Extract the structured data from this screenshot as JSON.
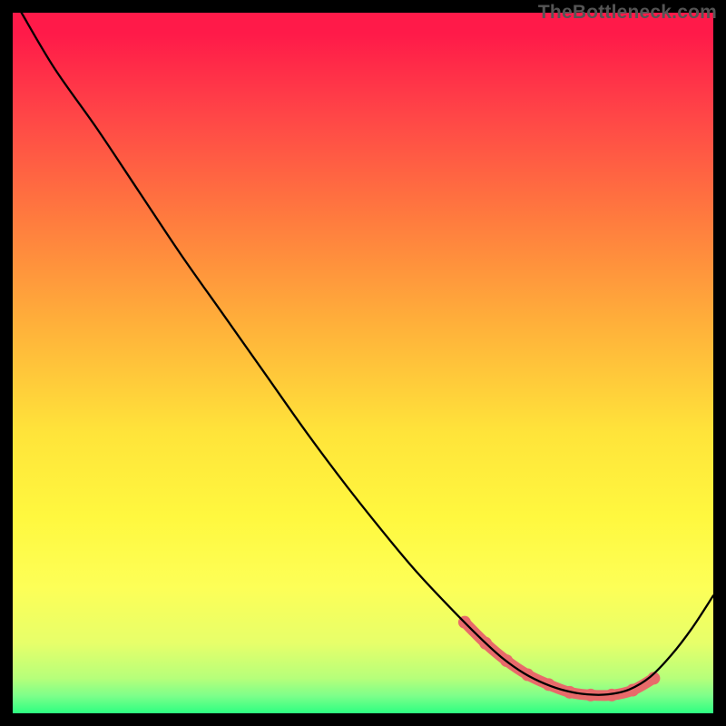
{
  "watermark": "TheBottleneck.com",
  "chart_data": {
    "type": "line",
    "title": "",
    "xlabel": "",
    "ylabel": "",
    "xlim": [
      0,
      100
    ],
    "ylim": [
      0,
      100
    ],
    "grid": false,
    "legend": false,
    "gradient_stops": [
      {
        "offset": 0.0,
        "color": "#ff1a49"
      },
      {
        "offset": 0.03,
        "color": "#ff1a49"
      },
      {
        "offset": 0.15,
        "color": "#ff4747"
      },
      {
        "offset": 0.3,
        "color": "#ff7d3e"
      },
      {
        "offset": 0.45,
        "color": "#ffb23a"
      },
      {
        "offset": 0.6,
        "color": "#ffe43a"
      },
      {
        "offset": 0.72,
        "color": "#fff83f"
      },
      {
        "offset": 0.82,
        "color": "#fdff57"
      },
      {
        "offset": 0.9,
        "color": "#e7ff6a"
      },
      {
        "offset": 0.95,
        "color": "#b6ff7a"
      },
      {
        "offset": 0.975,
        "color": "#7dff8a"
      },
      {
        "offset": 1.0,
        "color": "#2dff81"
      }
    ],
    "series": [
      {
        "name": "black-curve",
        "color": "#000000",
        "width": 2.3,
        "smooth": true,
        "x": [
          1.25,
          6,
          12,
          18,
          24,
          30,
          36,
          42,
          48,
          54,
          58,
          63,
          67,
          70,
          73,
          76,
          79,
          82,
          85,
          88,
          91,
          94,
          97,
          100
        ],
        "y": [
          100,
          92,
          83.5,
          74.5,
          65.5,
          57,
          48.5,
          40,
          32,
          24.5,
          19.8,
          14.5,
          10.5,
          7.8,
          5.7,
          4.2,
          3.2,
          2.7,
          2.7,
          3.4,
          5.2,
          8.3,
          12.2,
          16.8
        ]
      },
      {
        "name": "pink-highlight",
        "color": "#e86a6a",
        "width": 12,
        "smooth": true,
        "marker_radius": 7,
        "x": [
          64.5,
          67.5,
          70.5,
          73.5,
          76.5,
          79.5,
          82.5,
          85.5,
          88.5,
          91.5
        ],
        "y": [
          13,
          10,
          7.5,
          5.5,
          4.1,
          3.0,
          2.6,
          2.6,
          3.3,
          5.0
        ]
      }
    ],
    "annotations": []
  }
}
